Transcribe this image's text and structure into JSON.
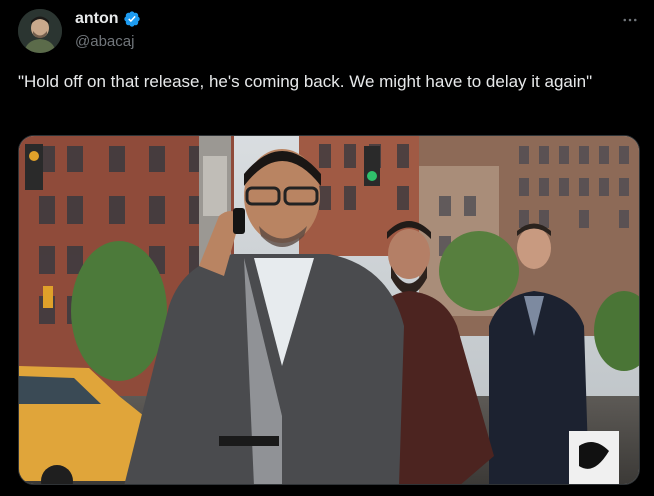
{
  "author": {
    "display_name": "anton",
    "handle": "@abacaj",
    "verified": true,
    "avatar_icon": "profile-photo",
    "verified_icon": "verified-badge-icon"
  },
  "actions": {
    "more_icon": "more-horizontal-icon"
  },
  "tweet": {
    "text": "\"Hold off on that release, he's coming back. We might have to delay it again\""
  },
  "media": {
    "kind": "photo",
    "subject": "street-scene-photo"
  },
  "colors": {
    "background": "#000000",
    "text": "#e7e9ea",
    "muted": "#71767b",
    "verified": "#1d9bf0",
    "border": "#2f3336"
  }
}
